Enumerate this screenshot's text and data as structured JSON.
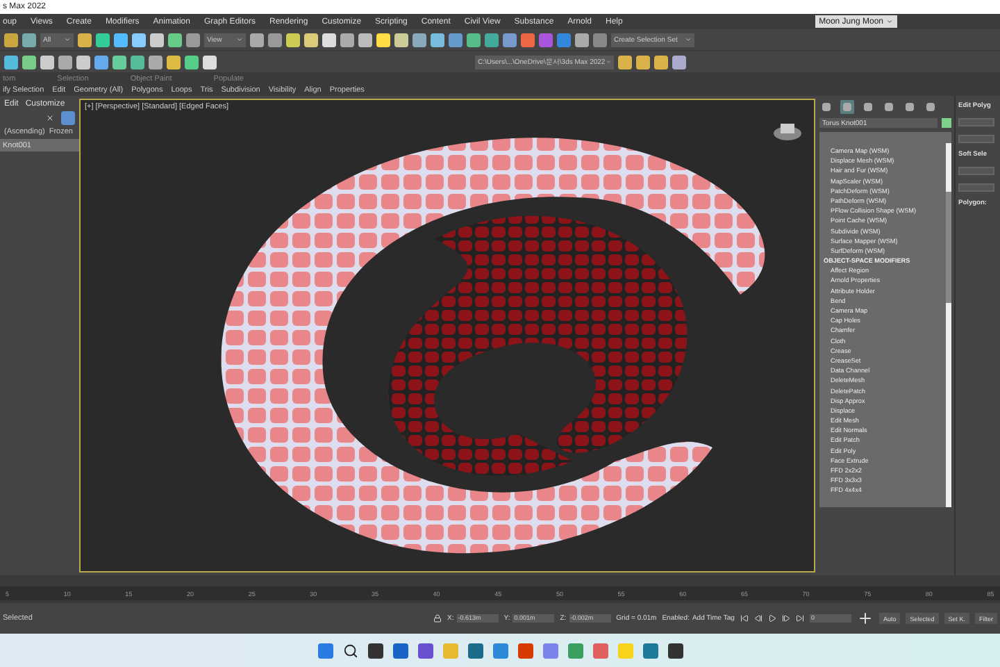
{
  "window": {
    "title": "s Max 2022"
  },
  "menu": [
    "oup",
    "Views",
    "Create",
    "Modifiers",
    "Animation",
    "Graph Editors",
    "Rendering",
    "Customize",
    "Scripting",
    "Content",
    "Civil View",
    "Substance",
    "Arnold",
    "Help"
  ],
  "user": "Moon Jung Moon",
  "toolbar": {
    "filter": "All",
    "reference": "View",
    "selection_set": "Create Selection Set",
    "project_path": "C:\\Users\\...\\OneDrive\\문서\\3ds Max 2022"
  },
  "ribbon": {
    "groups": [
      "tom",
      "Selection",
      "Object Paint",
      "Populate"
    ],
    "tabs": [
      "ify Selection",
      "Edit",
      "Geometry (All)",
      "Polygons",
      "Loops",
      "Tris",
      "Subdivision",
      "Visibility",
      "Align",
      "Properties"
    ]
  },
  "scene_explorer": {
    "menu": [
      "Edit",
      "Customize"
    ],
    "sort": "(Ascending)",
    "frozen": "Frozen",
    "rows": [
      {
        "label": "Knot001",
        "selected": true
      }
    ]
  },
  "viewport": {
    "label": "[+] [Perspective] [Standard] [Edged Faces]"
  },
  "command_panel": {
    "tabs": [
      {
        "selected": false
      },
      {
        "selected": true
      },
      {
        "selected": false
      },
      {
        "selected": false
      },
      {
        "selected": false
      },
      {
        "selected": false
      }
    ],
    "object_name": "Torus Knot001",
    "modifiers": [
      {
        "kind": "item",
        "label": "Camera Map (WSM)"
      },
      {
        "kind": "item",
        "label": "Displace Mesh (WSM)"
      },
      {
        "kind": "item",
        "label": "Hair and Fur (WSM)"
      },
      {
        "kind": "item",
        "label": "MapScaler (WSM)"
      },
      {
        "kind": "item",
        "label": "PatchDeform (WSM)"
      },
      {
        "kind": "item",
        "label": "PathDeform (WSM)"
      },
      {
        "kind": "item",
        "label": "PFlow Collision Shape (WSM)"
      },
      {
        "kind": "item",
        "label": "Point Cache (WSM)"
      },
      {
        "kind": "item",
        "label": "Subdivide (WSM)"
      },
      {
        "kind": "item",
        "label": "Surface Mapper (WSM)"
      },
      {
        "kind": "item",
        "label": "SurfDeform (WSM)"
      },
      {
        "kind": "header",
        "label": "OBJECT-SPACE MODIFIERS"
      },
      {
        "kind": "item",
        "label": "Affect Region"
      },
      {
        "kind": "item",
        "label": "Arnold Properties"
      },
      {
        "kind": "item",
        "label": "Attribute Holder"
      },
      {
        "kind": "item",
        "label": "Bend"
      },
      {
        "kind": "item",
        "label": "Camera Map"
      },
      {
        "kind": "item",
        "label": "Cap Holes"
      },
      {
        "kind": "item",
        "label": "Chamfer"
      },
      {
        "kind": "item",
        "label": "Cloth"
      },
      {
        "kind": "item",
        "label": "Crease"
      },
      {
        "kind": "item",
        "label": "CreaseSet"
      },
      {
        "kind": "item",
        "label": "Data Channel"
      },
      {
        "kind": "item",
        "label": "DeleteMesh"
      },
      {
        "kind": "item",
        "label": "DeletePatch"
      },
      {
        "kind": "item",
        "label": "Disp Approx"
      },
      {
        "kind": "item",
        "label": "Displace"
      },
      {
        "kind": "item",
        "label": "Edit Mesh"
      },
      {
        "kind": "item",
        "label": "Edit Normals"
      },
      {
        "kind": "item",
        "label": "Edit Patch"
      },
      {
        "kind": "item",
        "label": "Edit Poly"
      },
      {
        "kind": "item",
        "label": "Face Extrude"
      },
      {
        "kind": "item",
        "label": "FFD 2x2x2"
      },
      {
        "kind": "item",
        "label": "FFD 3x3x3"
      },
      {
        "kind": "item",
        "label": "FFD 4x4x4"
      }
    ],
    "rollouts": [
      "Edit Polyg",
      "Soft Sele",
      "Polygon:"
    ]
  },
  "timeline": {
    "ticks": [
      "5",
      "10",
      "15",
      "20",
      "25",
      "30",
      "35",
      "40",
      "45",
      "50",
      "55",
      "60",
      "65",
      "70",
      "75",
      "80",
      "85"
    ]
  },
  "status_bar": {
    "message": "Selected",
    "x_label": "X:",
    "y_label": "Y:",
    "z_label": "Z:",
    "x": "-0.613m",
    "y": "0.001m",
    "z": "-0.002m",
    "grid": "Grid = 0.01m",
    "enabled": "Enabled:",
    "time_tag": "Add Time Tag",
    "frame": "0",
    "buttons": [
      "Auto",
      "Selected",
      "Set K.",
      "Filter"
    ]
  }
}
